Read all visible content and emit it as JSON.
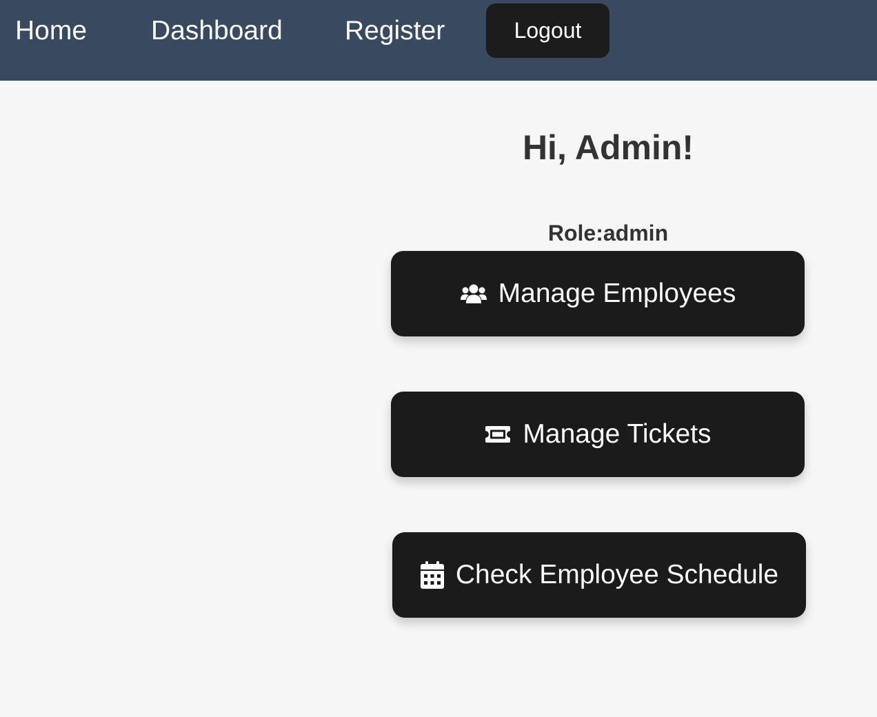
{
  "nav": {
    "home_label": "Home",
    "dashboard_label": "Dashboard",
    "register_label": "Register",
    "logout_label": "Logout"
  },
  "main": {
    "greeting": "Hi, Admin!",
    "role_text": "Role:admin",
    "actions": [
      {
        "label": "Manage Employees",
        "icon": "users-icon"
      },
      {
        "label": "Manage Tickets",
        "icon": "ticket-icon"
      },
      {
        "label": "Check Employee Schedule",
        "icon": "calendar-icon"
      }
    ]
  },
  "colors": {
    "navbar_bg": "#384960",
    "button_bg": "#1b1b1b",
    "page_bg": "#f6f6f6",
    "text_dark": "#333333"
  }
}
